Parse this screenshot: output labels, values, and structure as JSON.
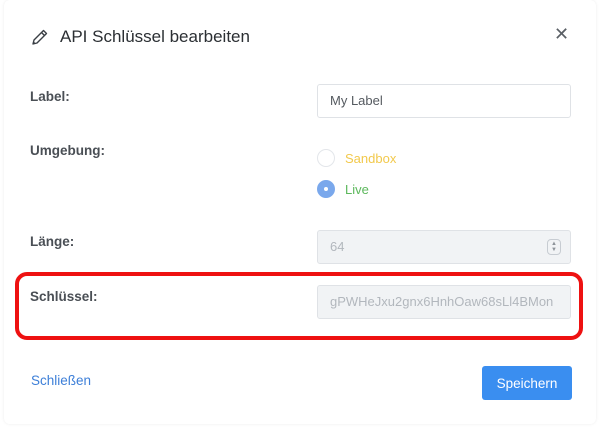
{
  "dialog": {
    "title": "API Schlüssel bearbeiten",
    "title_icon": "pencil-icon",
    "close_glyph": "✕"
  },
  "fields": {
    "label": {
      "label": "Label:",
      "value": "My Label"
    },
    "environment": {
      "label": "Umgebung:",
      "options": [
        {
          "label": "Sandbox",
          "checked": false,
          "color": "#f2c94c"
        },
        {
          "label": "Live",
          "checked": true,
          "color": "#5cb85c"
        }
      ]
    },
    "length": {
      "label": "Länge:",
      "value": "64"
    },
    "key": {
      "label": "Schlüssel:",
      "value": "gPWHeJxu2gnx6HnhOaw68sLl4BMon"
    }
  },
  "footer": {
    "close_label": "Schließen",
    "save_label": "Speichern"
  },
  "colors": {
    "accent": "#3a8ef0",
    "highlight": "#ee1111"
  }
}
